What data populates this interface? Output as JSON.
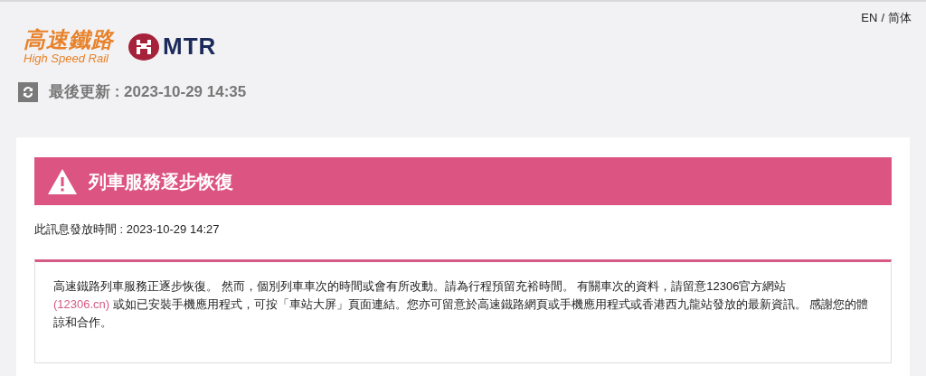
{
  "header": {
    "lang_en": "EN",
    "lang_separator": "/",
    "lang_sc": "简体",
    "logo_chinese": "高速鐵路",
    "logo_english": "High Speed Rail",
    "mtr_wordmark": "MTR"
  },
  "last_updated": "最後更新 : 2023-10-29 14:35",
  "alert": {
    "title": "列車服務逐步恢復",
    "issued": "此訊息發放時間 : 2023-10-29 14:27",
    "message_before": "高速鐵路列車服務正逐步恢復。 然而，個別列車車次的時間或會有所改動。請為行程預留充裕時間。 有關車次的資料，請留意12306官方網站",
    "link": "(12306.cn)",
    "message_after": " 或如已安裝手機應用程式，可按「車站大屏」頁面連結。您亦可留意於高速鐵路網頁或手機應用程式或香港西九龍站發放的最新資訊。 感謝您的體諒和合作。"
  }
}
